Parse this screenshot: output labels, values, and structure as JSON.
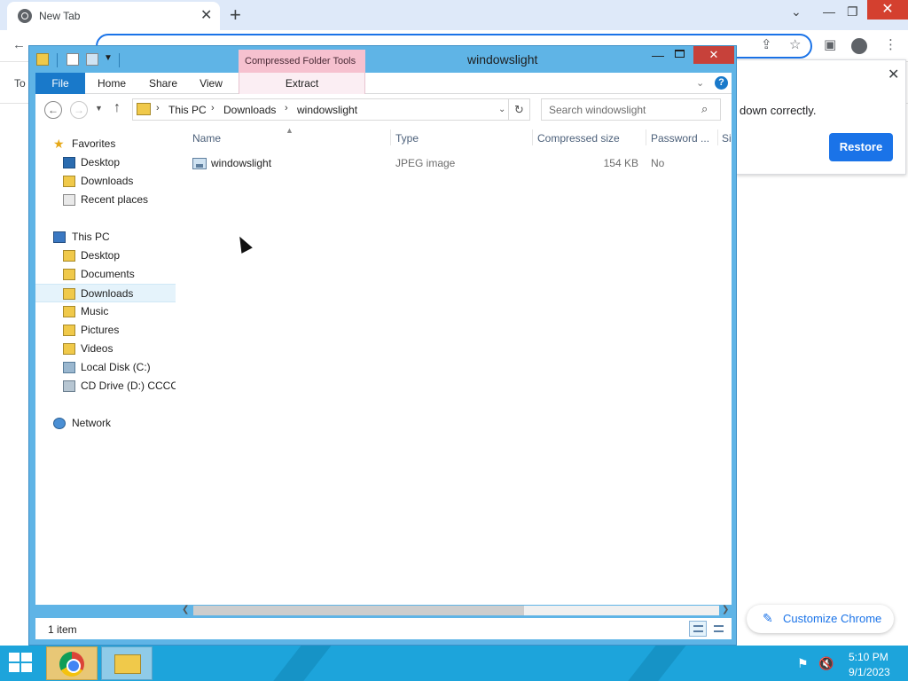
{
  "chrome": {
    "tab_title": "New Tab",
    "bookmarks_partial": "To",
    "restore_message": "down correctly.",
    "restore_button": "Restore",
    "customize_button": "Customize Chrome"
  },
  "explorer": {
    "window_title": "windowslight",
    "contextual_group": "Compressed Folder Tools",
    "ribbon_tabs": {
      "file": "File",
      "home": "Home",
      "share": "Share",
      "view": "View",
      "extract": "Extract"
    },
    "breadcrumb": [
      "This PC",
      "Downloads",
      "windowslight"
    ],
    "search_placeholder": "Search windowslight",
    "nav": {
      "favorites": "Favorites",
      "fav_items": [
        "Desktop",
        "Downloads",
        "Recent places"
      ],
      "this_pc": "This PC",
      "pc_items": [
        "Desktop",
        "Documents",
        "Downloads",
        "Music",
        "Pictures",
        "Videos",
        "Local Disk (C:)",
        "CD Drive (D:) CCCOI"
      ],
      "network": "Network"
    },
    "columns": {
      "name": "Name",
      "type": "Type",
      "compressed_size": "Compressed size",
      "password": "Password ...",
      "size": "Si"
    },
    "files": [
      {
        "name": "windowslight",
        "type": "JPEG image",
        "compressed_size": "154 KB",
        "password": "No"
      }
    ],
    "status": "1 item"
  },
  "taskbar": {
    "time": "5:10 PM",
    "date": "9/1/2023"
  },
  "colors": {
    "window_frame": "#5fb4e6",
    "file_tab": "#1979ca",
    "contextual_tab": "#f6c1cf",
    "taskbar": "#1da4db",
    "chrome_accent": "#1a73e8",
    "close_red": "#c7413a"
  }
}
